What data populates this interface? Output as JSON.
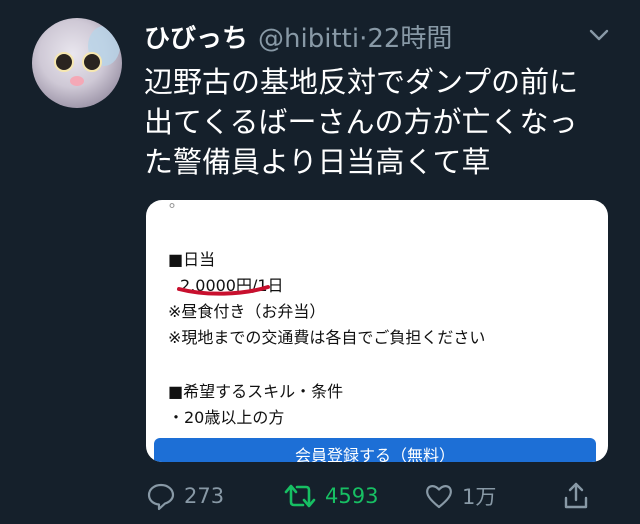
{
  "tweet": {
    "display_name": "ひびっち",
    "handle": "@hibitti",
    "dot": "·",
    "time": "22時間",
    "text": "辺野古の基地反対でダンプの前に\n出てくるばーさんの方が亡くなっ\nた警備員より日当高くて草"
  },
  "card": {
    "stray_mark": "°",
    "section_daily": "■日当",
    "wage": "2,0000円/1日",
    "lunch": "※昼食付き（お弁当）",
    "transport": "※現地までの交通費は各自でご負担ください",
    "section_skills": "■希望するスキル・条件",
    "age": "・20歳以上の方",
    "register_button": "会員登録する（無料）"
  },
  "actions": {
    "reply_count": "273",
    "retweet_count": "4593",
    "like_count": "1万"
  },
  "colors": {
    "background": "#15202b",
    "muted": "#8899a6",
    "retweet_green": "#17bf63",
    "underline_red": "#c8102e",
    "button_blue": "#1d6fd6"
  }
}
